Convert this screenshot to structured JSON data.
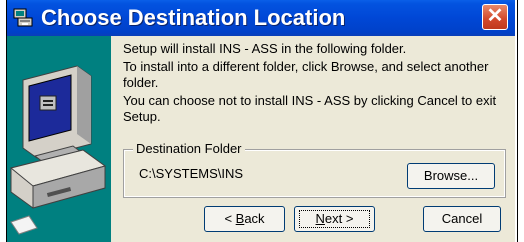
{
  "window": {
    "title": "Choose Destination Location",
    "close_glyph": "✕"
  },
  "message": {
    "line1": "Setup will install INS - ASS in the following folder.",
    "line2": "To install into a different folder, click Browse, and select another folder.",
    "line3": "You can choose not to install INS - ASS by clicking Cancel to exit Setup."
  },
  "destination": {
    "legend": "Destination Folder",
    "path": "C:\\SYSTEMS\\INS",
    "browse_label": "Browse..."
  },
  "buttons": {
    "back_key": "B",
    "back_rest": "ack",
    "back_prefix": "< ",
    "next_key": "N",
    "next_rest": "ext >",
    "cancel_label": "Cancel"
  },
  "icons": {
    "title": "setup-icon",
    "art": "computer-icon",
    "close": "close-icon"
  },
  "colors": {
    "titlebar": "#0047d6",
    "art_background": "#008080",
    "close": "#d1472a"
  }
}
